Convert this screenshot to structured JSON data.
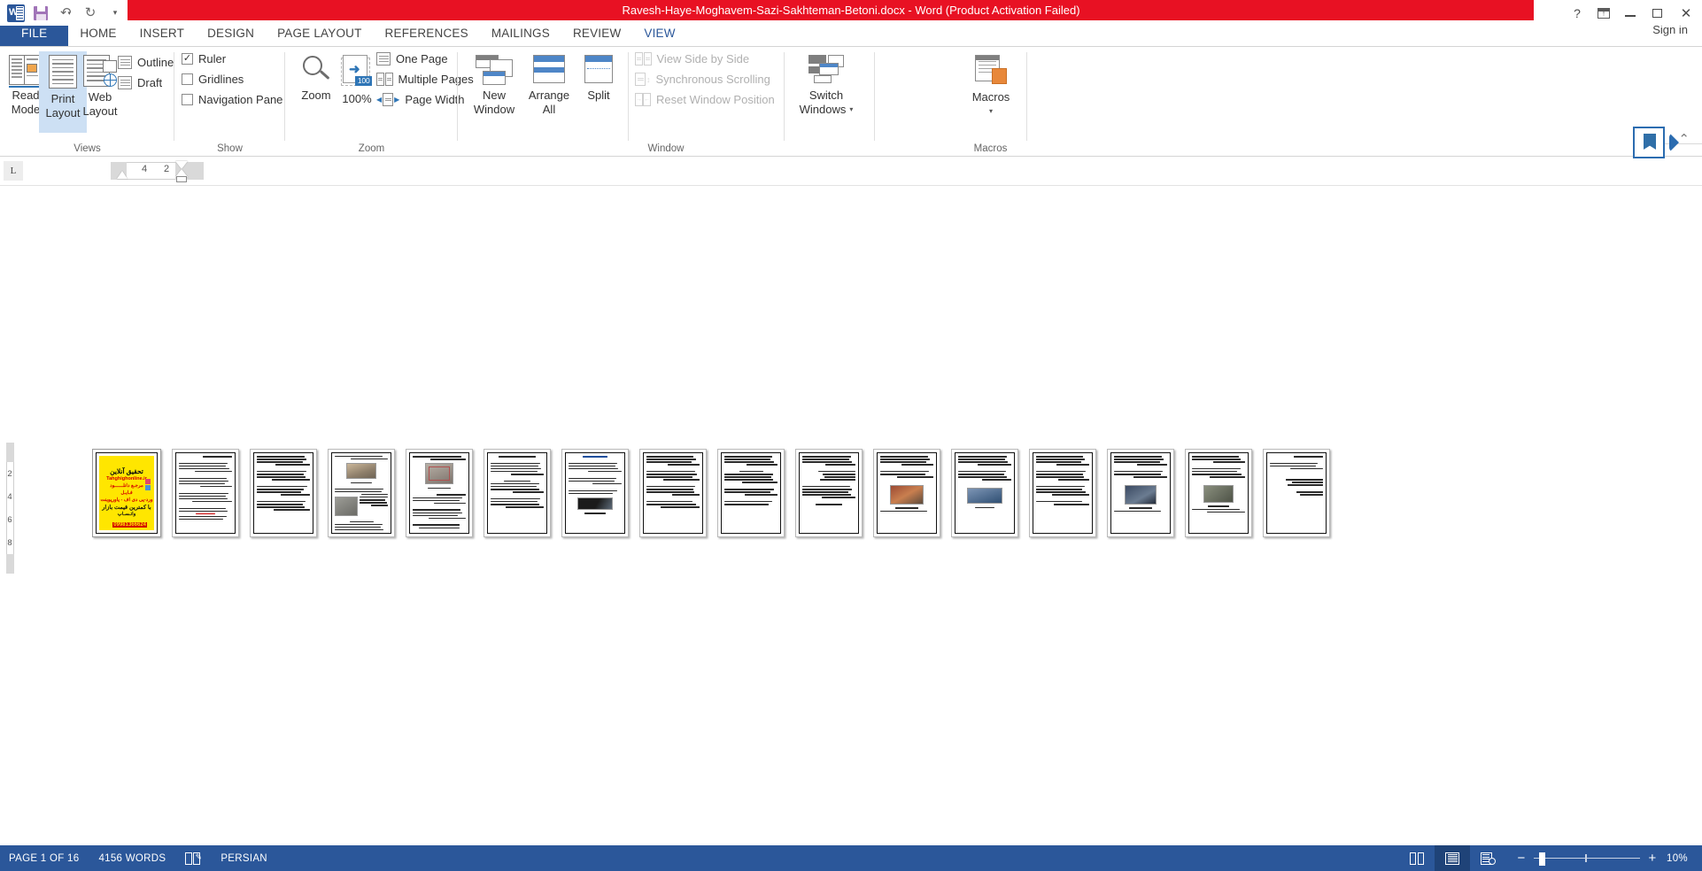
{
  "titlebar": {
    "document_title": "Ravesh-Haye-Moghavem-Sazi-Sakhteman-Betoni.docx  -  Word (Product Activation Failed)",
    "quick_access": [
      {
        "name": "word-logo",
        "label": "W"
      },
      {
        "name": "save-icon",
        "label": "Save"
      },
      {
        "name": "undo-icon",
        "label": "Undo"
      },
      {
        "name": "redo-icon",
        "label": "Redo"
      },
      {
        "name": "customize-qat-icon",
        "label": "Customize Quick Access Toolbar"
      }
    ],
    "help_label": "?",
    "ribbon_display_options_label": "Ribbon Display Options",
    "minimize_label": "Minimize",
    "restore_label": "Restore Down",
    "close_label": "✕",
    "signin_label": "Sign in"
  },
  "tabs": [
    {
      "label": "FILE",
      "active": false,
      "file": true
    },
    {
      "label": "HOME",
      "active": false
    },
    {
      "label": "INSERT",
      "active": false
    },
    {
      "label": "DESIGN",
      "active": false
    },
    {
      "label": "PAGE LAYOUT",
      "active": false
    },
    {
      "label": "REFERENCES",
      "active": false
    },
    {
      "label": "MAILINGS",
      "active": false
    },
    {
      "label": "REVIEW",
      "active": false
    },
    {
      "label": "VIEW",
      "active": true
    }
  ],
  "ribbon": {
    "groups": {
      "views": {
        "label": "Views",
        "buttons": [
          {
            "label_line1": "Read",
            "label_line2": "Mode",
            "selected": false
          },
          {
            "label_line1": "Print",
            "label_line2": "Layout",
            "selected": true
          },
          {
            "label_line1": "Web",
            "label_line2": "Layout",
            "selected": false
          }
        ],
        "small_items": [
          {
            "label": "Outline",
            "enabled": true
          },
          {
            "label": "Draft",
            "enabled": true
          }
        ]
      },
      "show": {
        "label": "Show",
        "checkboxes": [
          {
            "label": "Ruler",
            "checked": true
          },
          {
            "label": "Gridlines",
            "checked": false
          },
          {
            "label": "Navigation Pane",
            "checked": false
          }
        ]
      },
      "zoom": {
        "label": "Zoom",
        "buttons": [
          {
            "label": "Zoom"
          },
          {
            "label": "100%",
            "badge": "100"
          }
        ],
        "small_items": [
          {
            "label": "One Page"
          },
          {
            "label": "Multiple Pages"
          },
          {
            "label": "Page Width"
          }
        ]
      },
      "window": {
        "label": "Window",
        "buttons": [
          {
            "label_line1": "New",
            "label_line2": "Window"
          },
          {
            "label_line1": "Arrange",
            "label_line2": "All"
          },
          {
            "label_line1": "Split",
            "label_line2": ""
          }
        ],
        "small_items": [
          {
            "label": "View Side by Side",
            "enabled": false
          },
          {
            "label": "Synchronous Scrolling",
            "enabled": false
          },
          {
            "label": "Reset Window Position",
            "enabled": false
          }
        ],
        "switch_windows": {
          "label_line1": "Switch",
          "label_line2": "Windows",
          "has_dropdown": true
        }
      },
      "macros": {
        "label": "Macros",
        "button": {
          "label": "Macros",
          "has_dropdown": true
        }
      }
    }
  },
  "ruler": {
    "tab_stop_marker": "L",
    "numbers": [
      "4",
      "2"
    ]
  },
  "document": {
    "vertical_ruler_numbers": [
      "2",
      "4",
      "6",
      "8"
    ],
    "page_count_shown": 16,
    "cover_page": {
      "title": "تحقیق آنلاین",
      "site": "Tahghighonline.ir",
      "line1": "مرجـع دانلــــــود",
      "line2": "فـایـل",
      "line3": "ورد-پی دی اف - پاورپوینت",
      "line4": "با کمترین قیمت بازار",
      "phone": "09981366624",
      "whatsapp": "واتـسـاپ"
    },
    "pages": [
      {
        "index": 1,
        "type": "cover"
      },
      {
        "index": 2,
        "type": "text"
      },
      {
        "index": 3,
        "type": "text"
      },
      {
        "index": 4,
        "type": "text-image",
        "images": 2
      },
      {
        "index": 5,
        "type": "text-image",
        "images": 1
      },
      {
        "index": 6,
        "type": "text"
      },
      {
        "index": 7,
        "type": "text-image",
        "images": 1
      },
      {
        "index": 8,
        "type": "text"
      },
      {
        "index": 9,
        "type": "text"
      },
      {
        "index": 10,
        "type": "text"
      },
      {
        "index": 11,
        "type": "text-image",
        "images": 1
      },
      {
        "index": 12,
        "type": "text-image",
        "images": 1
      },
      {
        "index": 13,
        "type": "text"
      },
      {
        "index": 14,
        "type": "text-image",
        "images": 1
      },
      {
        "index": 15,
        "type": "text-image",
        "images": 1
      },
      {
        "index": 16,
        "type": "text"
      }
    ]
  },
  "statusbar": {
    "page_indicator": "PAGE 1 OF 16",
    "word_count": "4156 WORDS",
    "proofing_icon": "proofing-errors-icon",
    "language": "PERSIAN",
    "view_buttons": [
      {
        "name": "read-mode-view-button",
        "active": false
      },
      {
        "name": "print-layout-view-button",
        "active": true
      },
      {
        "name": "web-layout-view-button",
        "active": false
      }
    ],
    "zoom_out_label": "−",
    "zoom_in_label": "+",
    "zoom_level": "10%"
  },
  "colors": {
    "title_red": "#e81123",
    "word_blue": "#2b579a",
    "accent_blue": "#2e75b6",
    "selection_blue": "#cde0f4",
    "cover_yellow": "#ffe600"
  }
}
